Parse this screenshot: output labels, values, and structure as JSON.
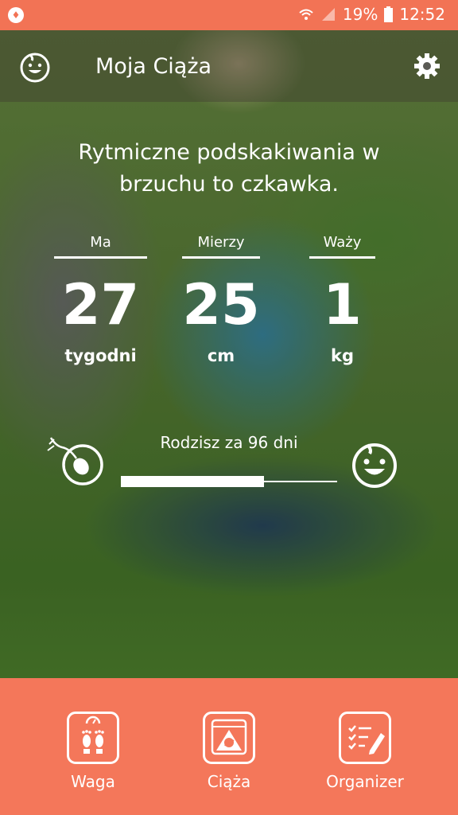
{
  "status_bar": {
    "battery": "19%",
    "time": "12:52"
  },
  "toolbar": {
    "title": "Moja Ciąża"
  },
  "fact": "Rytmiczne podskakiwania w brzuchu to czkawka.",
  "stats": [
    {
      "label": "Ma",
      "value": "27",
      "unit": "tygodni"
    },
    {
      "label": "Mierzy",
      "value": "25",
      "unit": "cm"
    },
    {
      "label": "Waży",
      "value": "1",
      "unit": "kg"
    }
  ],
  "due": {
    "text": "Rodzisz za 96 dni",
    "progress_fraction": 0.66
  },
  "bottom_nav": {
    "items": [
      {
        "label": "Waga",
        "icon": "scale-feet-icon"
      },
      {
        "label": "Ciąża",
        "icon": "ultrasound-icon"
      },
      {
        "label": "Organizer",
        "icon": "checklist-icon"
      }
    ]
  },
  "colors": {
    "accent": "#f4775a",
    "status_bar": "#f27355"
  }
}
